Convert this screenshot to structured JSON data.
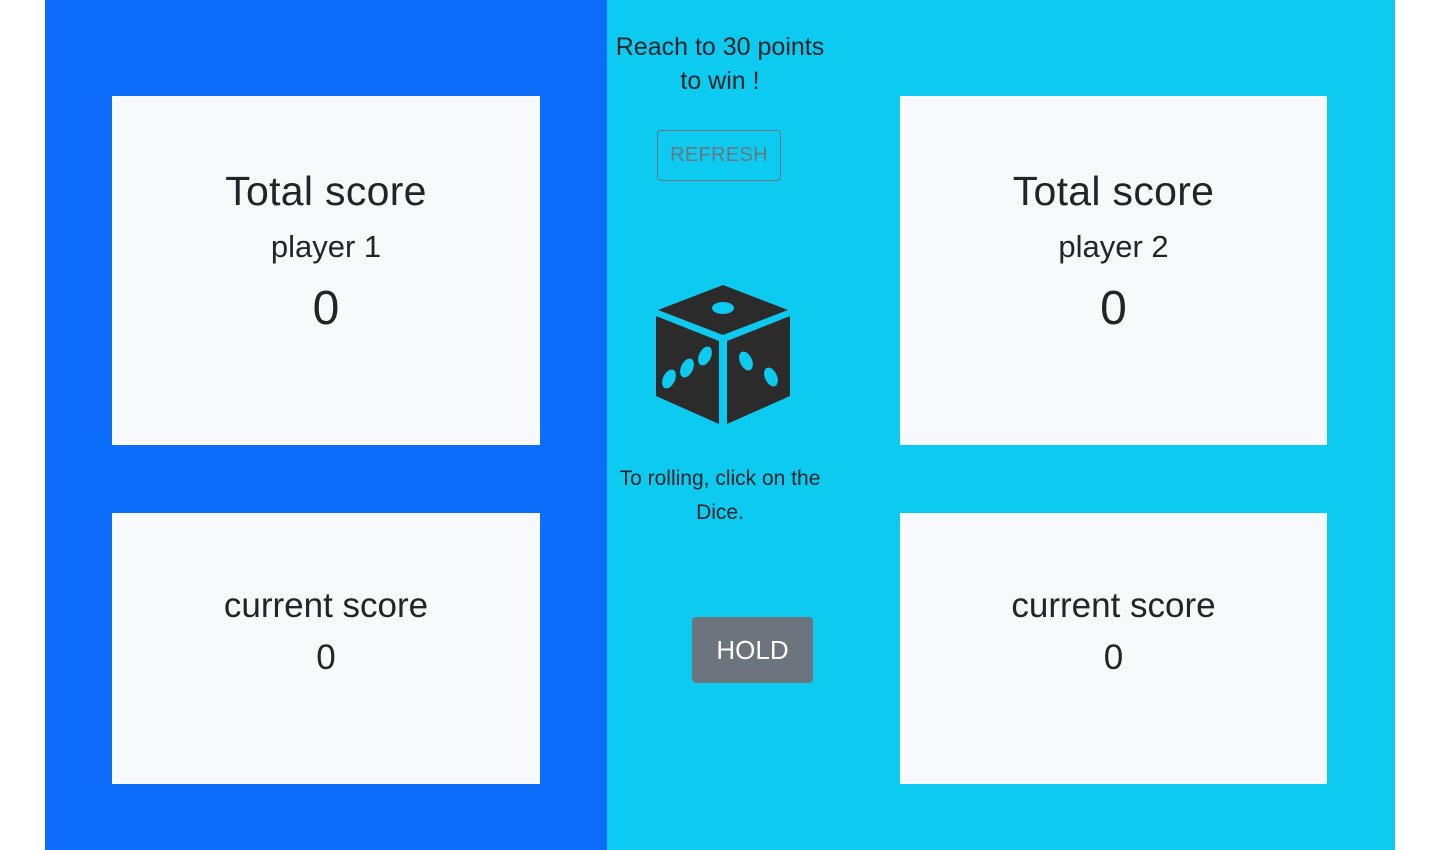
{
  "game": {
    "goal_text": "Reach to 30 points to win !",
    "refresh_label": "REFRESH",
    "dice_hint": "To rolling, click on the Dice.",
    "hold_label": "HOLD",
    "dice_icon": "dice-icon"
  },
  "players": [
    {
      "total_title": "Total score",
      "name": "player 1",
      "total_score": "0",
      "current_title": "current score",
      "current_score": "0"
    },
    {
      "total_title": "Total score",
      "name": "player 2",
      "total_score": "0",
      "current_title": "current score",
      "current_score": "0"
    }
  ],
  "colors": {
    "player1_panel": "#0d6efd",
    "player2_panel": "#0dcaf0",
    "card": "#f8f9fa",
    "hold_button": "#6c757d",
    "dice": "#2b2b2b"
  }
}
